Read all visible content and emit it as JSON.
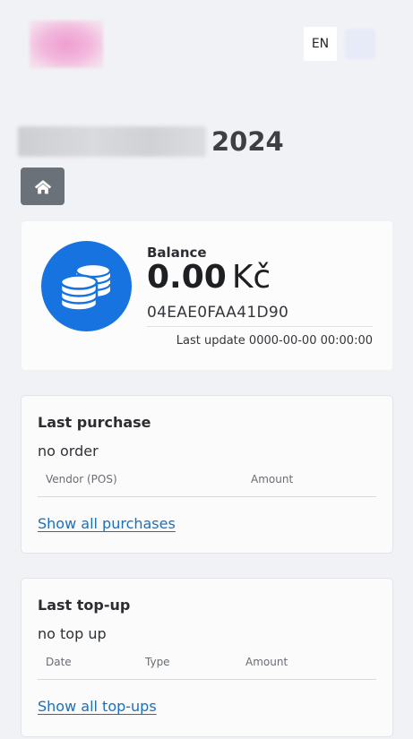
{
  "header": {
    "language": "EN",
    "logo_icon": "brand-logo-blurred",
    "user_icon": "user-avatar-blurred"
  },
  "event": {
    "title_year": "2024"
  },
  "nav": {
    "home_icon": "home-icon"
  },
  "balance": {
    "label": "Balance",
    "amount": "0.00",
    "currency": "Kč",
    "card_id": "04EAE0FAA41D90",
    "last_update_label": "Last update",
    "last_update_value": "0000-00-00 00:00:00",
    "icon": "coins-icon",
    "accent_color": "#1673e0"
  },
  "last_purchase": {
    "title": "Last purchase",
    "empty_text": "no order",
    "columns": [
      "Vendor (POS)",
      "Amount"
    ],
    "link": "Show all purchases"
  },
  "last_topup": {
    "title": "Last top-up",
    "empty_text": "no top up",
    "columns": [
      "Date",
      "Type",
      "Amount"
    ],
    "link": "Show all top-ups"
  }
}
